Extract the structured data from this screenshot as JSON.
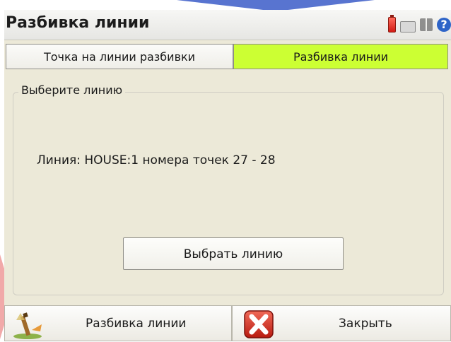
{
  "window": {
    "title": "Разбивка линии",
    "tray_icons": [
      "battery-icon",
      "keyboard-icon",
      "grid-icon",
      "help-icon"
    ],
    "help_glyph": "?"
  },
  "tabs": [
    {
      "label": "Точка на линии разбивки",
      "active": false
    },
    {
      "label": "Разбивка линии",
      "active": true
    }
  ],
  "group": {
    "legend": "Выберите линию",
    "info": "Линия: HOUSE:1 номера точек 27 - 28",
    "select_button": "Выбрать линию"
  },
  "bottom": {
    "stake_label": "Разбивка линии",
    "close_label": "Закрыть"
  },
  "colors": {
    "active_tab": "#ccff33",
    "window_bg": "#ece9d8",
    "close_red": "#d82a1c"
  }
}
